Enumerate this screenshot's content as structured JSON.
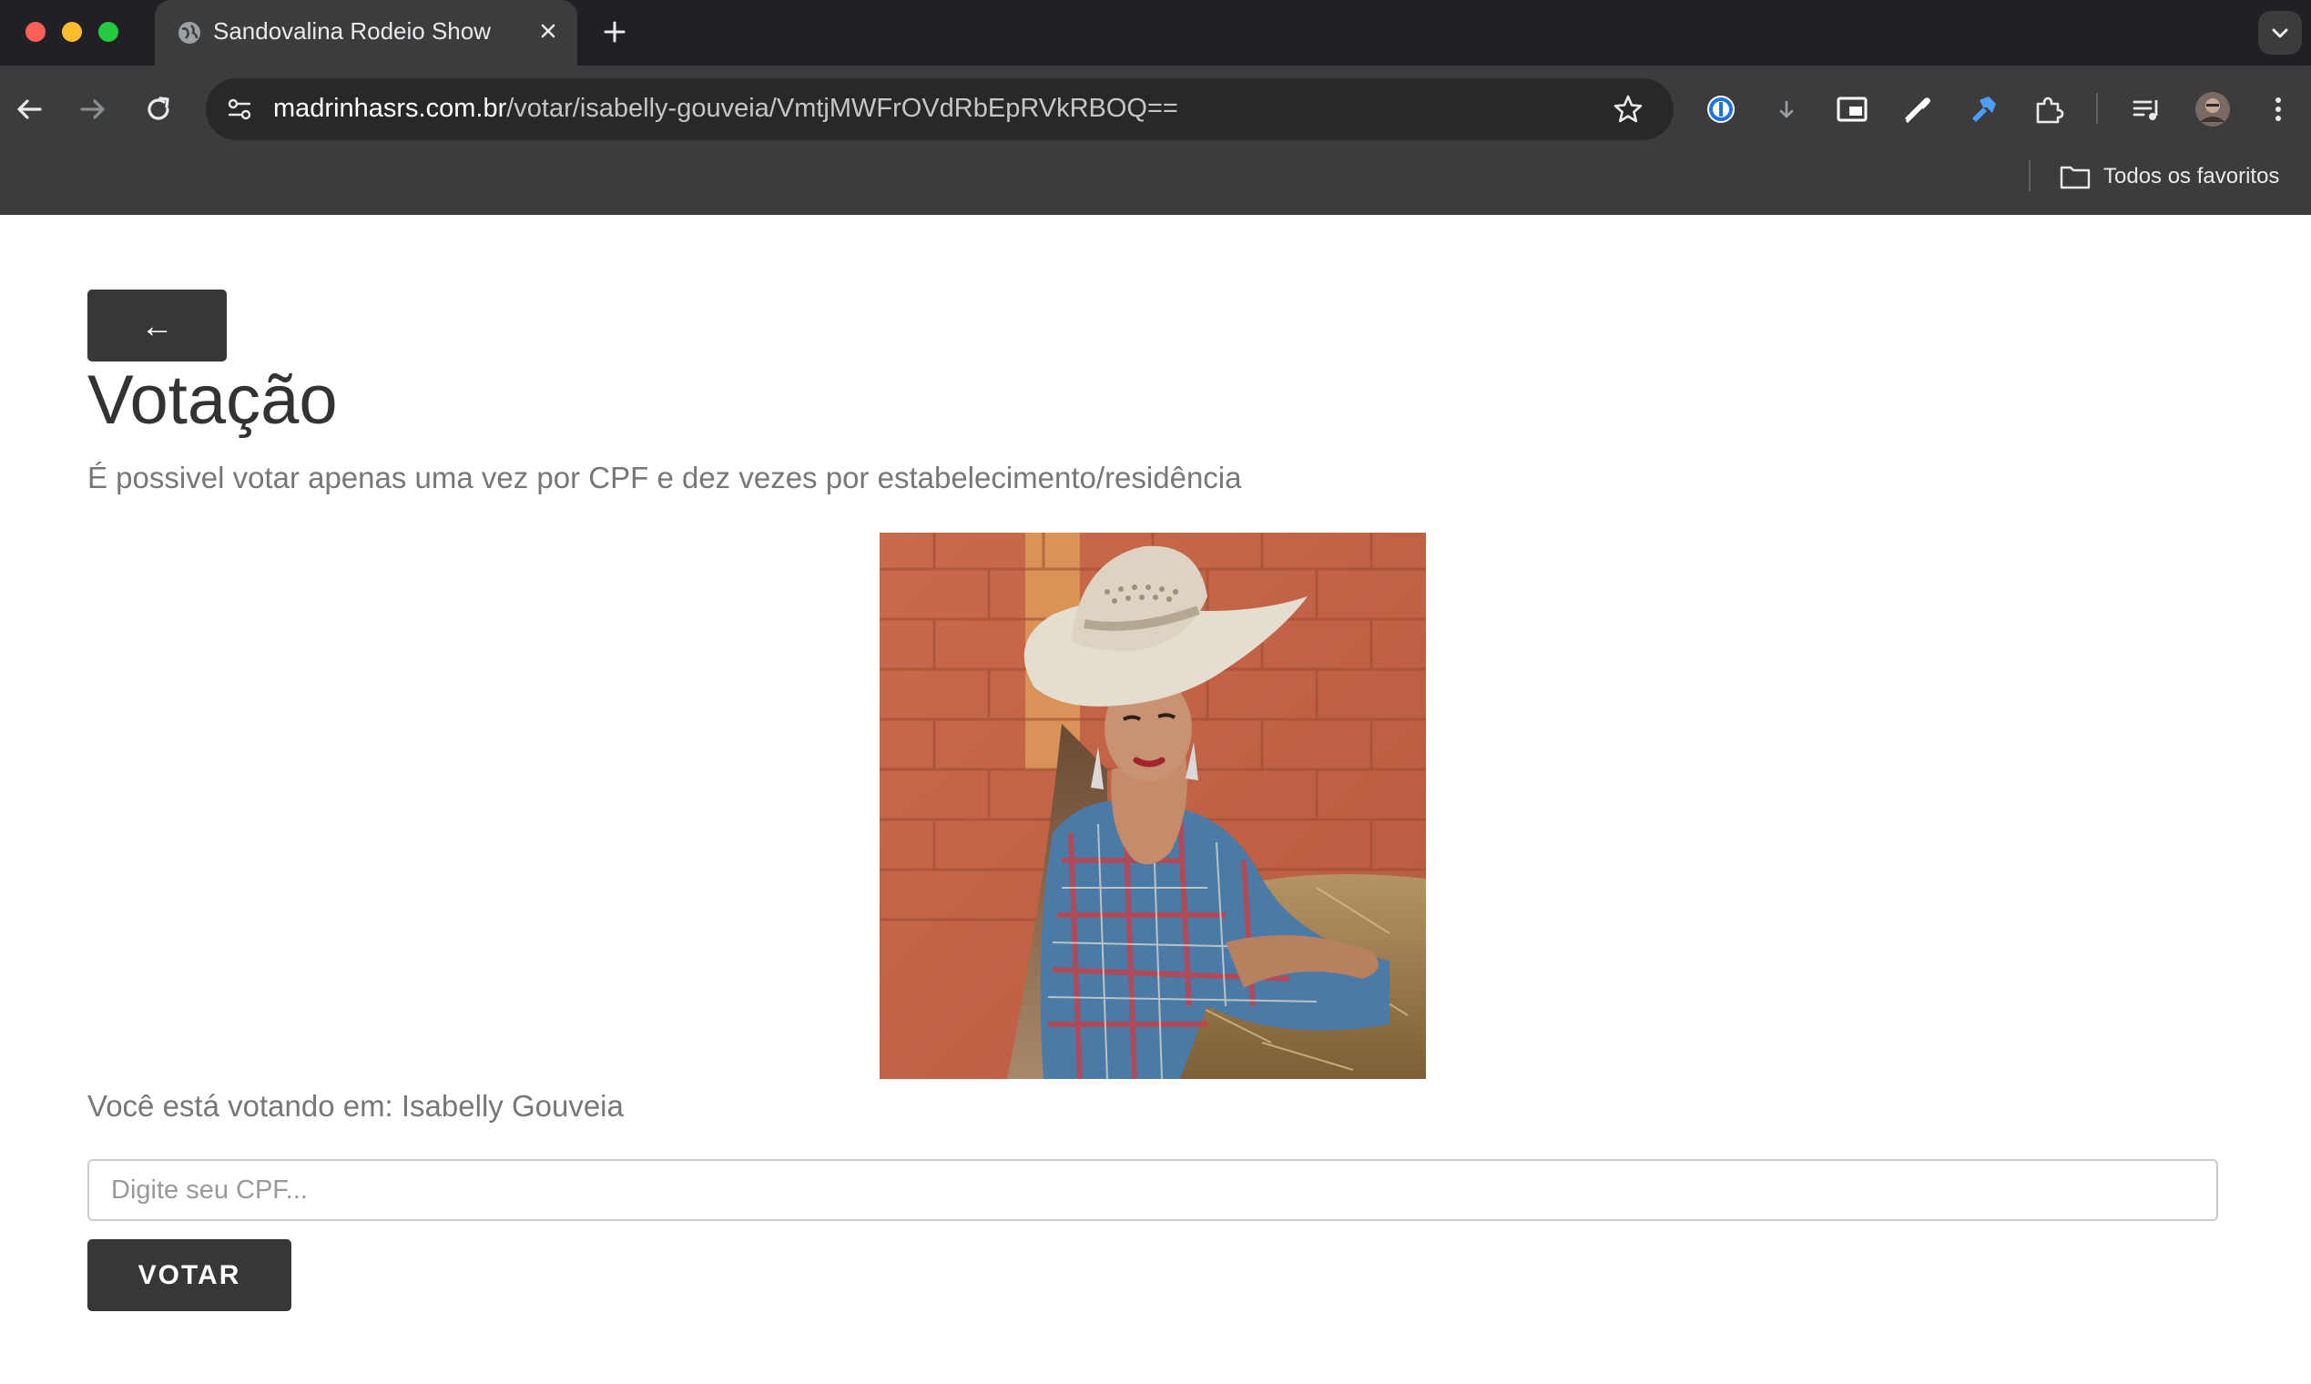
{
  "browser": {
    "tab_title": "Sandovalina Rodeio Show",
    "url_host": "madrinhasrs.com.br",
    "url_path": "/votar/isabelly-gouveia/VmtjMWFrOVdRbEpRVkRBOQ==",
    "bookmarks_label": "Todos os favoritos",
    "icons": {
      "favicon": "globe-icon",
      "close": "close-icon",
      "new_tab": "plus-icon",
      "back": "arrow-left-icon",
      "forward": "arrow-right-icon",
      "reload": "reload-icon",
      "site_info": "tune-icon",
      "bookmark": "star-icon",
      "folder": "folder-icon"
    },
    "colors": {
      "tabstrip": "#202124",
      "toolbar": "#3c3c3c",
      "omnibox": "#282828"
    }
  },
  "page": {
    "back_label": "←",
    "title": "Votação",
    "subtitle": "É possivel votar apenas uma vez por CPF e dez vezes por estabelecimento/residência",
    "voting_for": "Você está votando em: Isabelly Gouveia",
    "cpf_placeholder": "Digite seu CPF...",
    "vote_label": "VOTAR",
    "colors": {
      "button": "#373737",
      "title": "#333333",
      "muted_text": "#777777"
    }
  }
}
